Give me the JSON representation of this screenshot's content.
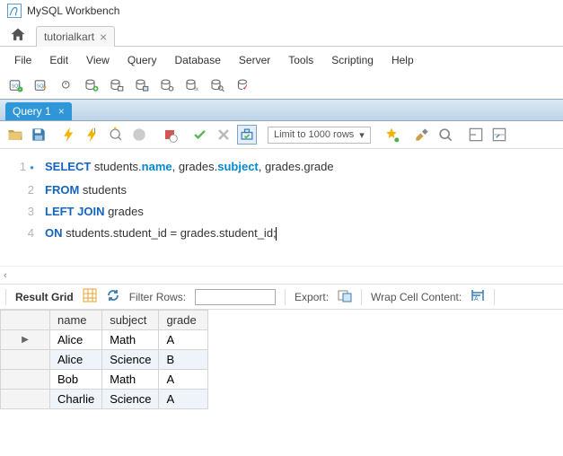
{
  "app": {
    "title": "MySQL Workbench"
  },
  "connection_tab": {
    "label": "tutorialkart"
  },
  "menu": {
    "file": "File",
    "edit": "Edit",
    "view": "View",
    "query": "Query",
    "database": "Database",
    "server": "Server",
    "tools": "Tools",
    "scripting": "Scripting",
    "help": "Help"
  },
  "query_tab": {
    "label": "Query 1"
  },
  "editor_toolbar": {
    "limit": "Limit to 1000 rows"
  },
  "sql": {
    "line1": {
      "n": "1",
      "kw1": "SELECT",
      "a": " students.",
      "fn1": "name",
      "b": ", grades.",
      "fn2": "subject",
      "c": ", grades.grade"
    },
    "line2": {
      "n": "2",
      "kw1": "FROM",
      "a": " students"
    },
    "line3": {
      "n": "3",
      "kw1": "LEFT",
      "kw2": "JOIN",
      "a": " grades"
    },
    "line4": {
      "n": "4",
      "kw1": "ON",
      "a": " students.student_id ",
      "eq": "=",
      "b": " grades.student_id;"
    }
  },
  "result_bar": {
    "grid_label": "Result Grid",
    "filter_label": "Filter Rows:",
    "export_label": "Export:",
    "wrap_label": "Wrap Cell Content:"
  },
  "results": {
    "headers": {
      "c1": "name",
      "c2": "subject",
      "c3": "grade"
    },
    "rows": [
      {
        "marker": "▶",
        "c1": "Alice",
        "c2": "Math",
        "c3": "A"
      },
      {
        "marker": "",
        "c1": "Alice",
        "c2": "Science",
        "c3": "B"
      },
      {
        "marker": "",
        "c1": "Bob",
        "c2": "Math",
        "c3": "A"
      },
      {
        "marker": "",
        "c1": "Charlie",
        "c2": "Science",
        "c3": "A"
      }
    ]
  }
}
